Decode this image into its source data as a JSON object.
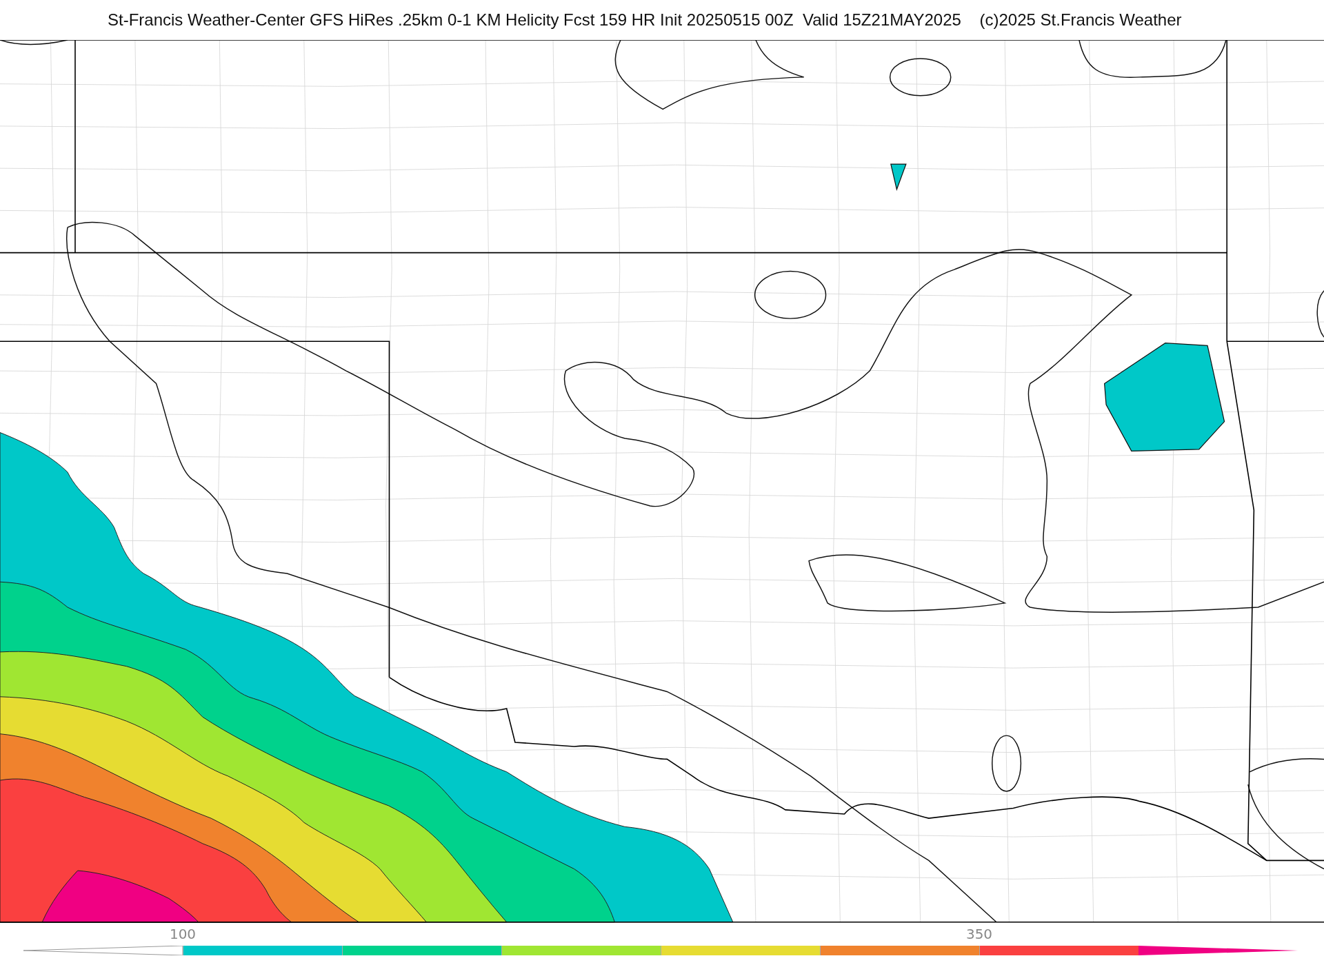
{
  "title": "St-Francis Weather-Center GFS HiRes .25km 0-1 KM Helicity Fcst 159 HR Init 20250515 00Z  Valid 15Z21MAY2025    (c)2025 St.Francis Weather",
  "colorbar": {
    "segments": [
      {
        "kind": "arrow-left",
        "color": "#ffffff"
      },
      {
        "kind": "box",
        "color": "#00c8c8",
        "tick": "100"
      },
      {
        "kind": "box",
        "color": "#00d28c"
      },
      {
        "kind": "box",
        "color": "#a0e632"
      },
      {
        "kind": "box",
        "color": "#e6dc32"
      },
      {
        "kind": "box",
        "color": "#f0822d"
      },
      {
        "kind": "box",
        "color": "#fa4040",
        "tick": "350"
      },
      {
        "kind": "arrow-right",
        "color": "#f00082"
      }
    ]
  }
}
